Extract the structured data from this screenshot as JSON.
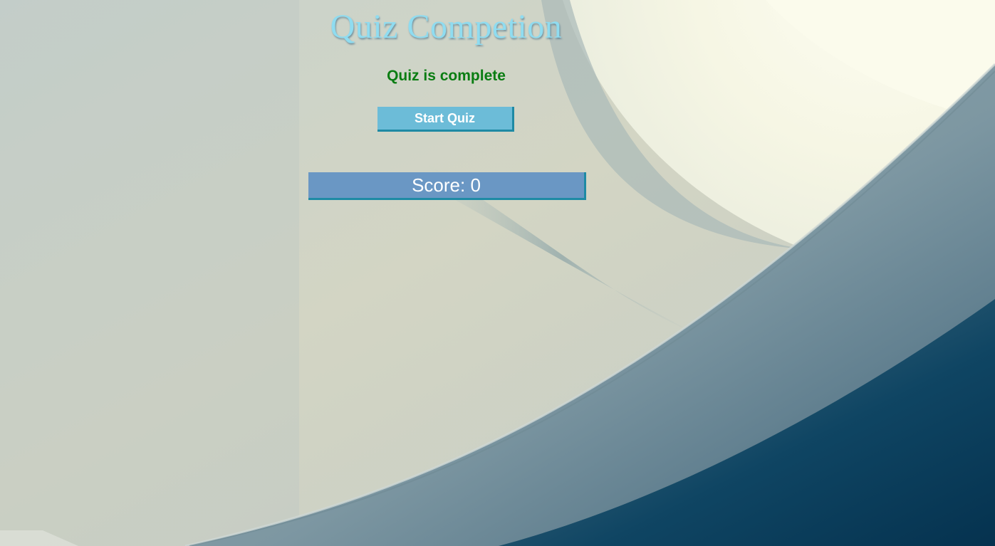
{
  "header": {
    "title": "Quiz Competion"
  },
  "quiz": {
    "status_text": "Quiz is complete",
    "start_button_label": "Start Quiz",
    "score_label": "Score: 0"
  },
  "colors": {
    "title": "#8fdcf0",
    "status": "#0a7d12",
    "start_button_bg": "#6cbcd8",
    "score_bg": "#6a97c4",
    "button_border": "#1e8aa4"
  }
}
